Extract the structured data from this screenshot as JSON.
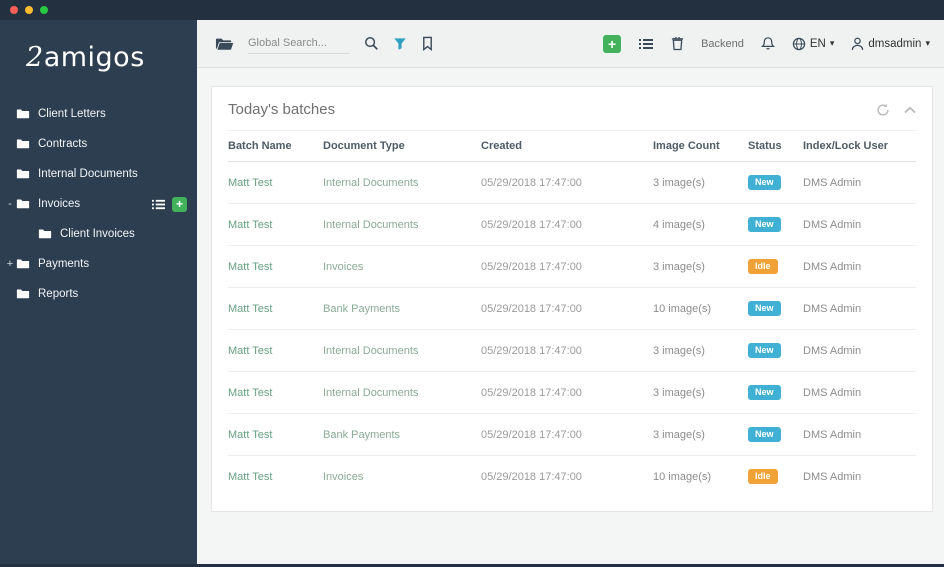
{
  "window": {
    "traffic_lights": [
      "close",
      "minimize",
      "zoom"
    ]
  },
  "sidebar": {
    "logo": {
      "prefix": "2",
      "rest": "amigos"
    },
    "items": [
      {
        "label": "Client Letters"
      },
      {
        "label": "Contracts"
      },
      {
        "label": "Internal Documents"
      },
      {
        "label": "Invoices",
        "toggle": "-",
        "has_actions": true
      },
      {
        "label": "Client Invoices",
        "nested": true
      },
      {
        "label": "Payments",
        "toggle": "+"
      },
      {
        "label": "Reports"
      }
    ],
    "invoices_add_label": "+"
  },
  "topbar": {
    "search_placeholder": "Global Search...",
    "add_button_label": "+",
    "backend_label": "Backend",
    "language": "EN",
    "username": "dmsadmin",
    "caret_glyph": "▾"
  },
  "panel": {
    "title": "Today's batches"
  },
  "table": {
    "headers": [
      "Batch Name",
      "Document Type",
      "Created",
      "Image Count",
      "Status",
      "Index/Lock User"
    ],
    "rows": [
      {
        "batch": "Matt Test",
        "type": "Internal Documents",
        "created": "05/29/2018 17:47:00",
        "count": "3 image(s)",
        "status": "New",
        "user": "DMS Admin"
      },
      {
        "batch": "Matt Test",
        "type": "Internal Documents",
        "created": "05/29/2018 17:47:00",
        "count": "4 image(s)",
        "status": "New",
        "user": "DMS Admin"
      },
      {
        "batch": "Matt Test",
        "type": "Invoices",
        "created": "05/29/2018 17:47:00",
        "count": "3 image(s)",
        "status": "Idle",
        "user": "DMS Admin"
      },
      {
        "batch": "Matt Test",
        "type": "Bank Payments",
        "created": "05/29/2018 17:47:00",
        "count": "10 image(s)",
        "status": "New",
        "user": "DMS Admin"
      },
      {
        "batch": "Matt Test",
        "type": "Internal Documents",
        "created": "05/29/2018 17:47:00",
        "count": "3 image(s)",
        "status": "New",
        "user": "DMS Admin"
      },
      {
        "batch": "Matt Test",
        "type": "Internal Documents",
        "created": "05/29/2018 17:47:00",
        "count": "3 image(s)",
        "status": "New",
        "user": "DMS Admin"
      },
      {
        "batch": "Matt Test",
        "type": "Bank Payments",
        "created": "05/29/2018 17:47:00",
        "count": "3 image(s)",
        "status": "New",
        "user": "DMS Admin"
      },
      {
        "batch": "Matt Test",
        "type": "Invoices",
        "created": "05/29/2018 17:47:00",
        "count": "10 image(s)",
        "status": "Idle",
        "user": "DMS Admin"
      }
    ]
  },
  "colors": {
    "sidebar_bg": "#2d3e50",
    "accent_green": "#43b05c",
    "badge_new": "#41b0d5",
    "badge_idle": "#f0a236"
  },
  "badge_colors": {
    "New": "#41b0d5",
    "Idle": "#f0a236"
  }
}
